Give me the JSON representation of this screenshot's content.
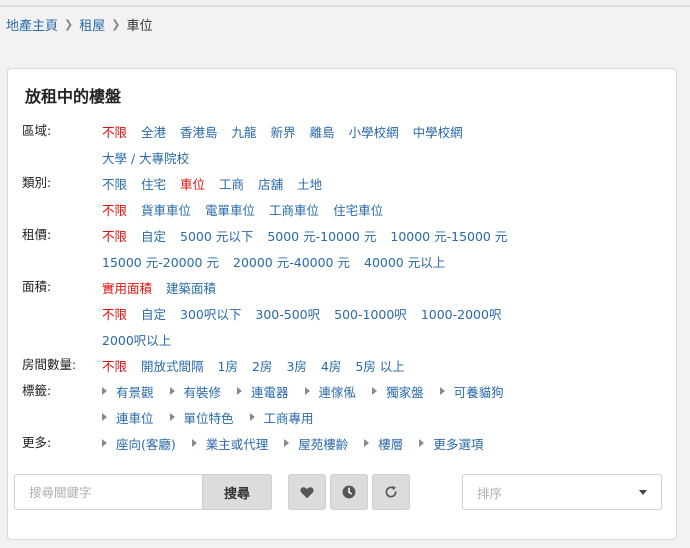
{
  "breadcrumb": {
    "home": "地產主頁",
    "rent": "租屋",
    "current": "車位"
  },
  "panel": {
    "title": "放租中的樓盤"
  },
  "filters": {
    "region": {
      "label": "區域:",
      "line1": [
        "不限",
        "全港",
        "香港島",
        "九龍",
        "新界",
        "離島",
        "小學校網",
        "中學校網"
      ],
      "line2": [
        "大學 / 大專院校"
      ]
    },
    "category": {
      "label": "類別:",
      "line1": [
        "不限",
        "住宅",
        "車位",
        "工商",
        "店舖",
        "土地"
      ],
      "line2": [
        "不限",
        "貨車車位",
        "電單車位",
        "工商車位",
        "住宅車位"
      ]
    },
    "rent": {
      "label": "租價:",
      "line1": [
        "不限",
        "自定",
        "5000 元以下",
        "5000 元-10000 元",
        "10000 元-15000 元"
      ],
      "line2": [
        "15000 元-20000 元",
        "20000 元-40000 元",
        "40000 元以上"
      ]
    },
    "area": {
      "label": "面積:",
      "line1": [
        "實用面積",
        "建築面積"
      ],
      "line2": [
        "不限",
        "自定",
        "300呎以下",
        "300-500呎",
        "500-1000呎",
        "1000-2000呎"
      ],
      "line3": [
        "2000呎以上"
      ]
    },
    "rooms": {
      "label": "房間數量:",
      "line1": [
        "不限",
        "開放式間隔",
        "1房",
        "2房",
        "3房",
        "4房",
        "5房 以上"
      ]
    },
    "tags": {
      "label": "標籤:",
      "line1": [
        "有景觀",
        "有裝修",
        "連電器",
        "連傢俬",
        "獨家盤",
        "可養貓狗"
      ],
      "line2": [
        "連車位",
        "單位特色",
        "工商專用"
      ]
    },
    "more": {
      "label": "更多:",
      "line1": [
        "座向(客廳)",
        "業主或代理",
        "屋苑樓齡",
        "樓層",
        "更多選項"
      ]
    }
  },
  "search": {
    "placeholder": "搜尋關鍵字",
    "button_label": "搜尋"
  },
  "sort": {
    "placeholder": "排序"
  },
  "colors": {
    "link": "#2a6aa8",
    "active": "#e01010"
  }
}
